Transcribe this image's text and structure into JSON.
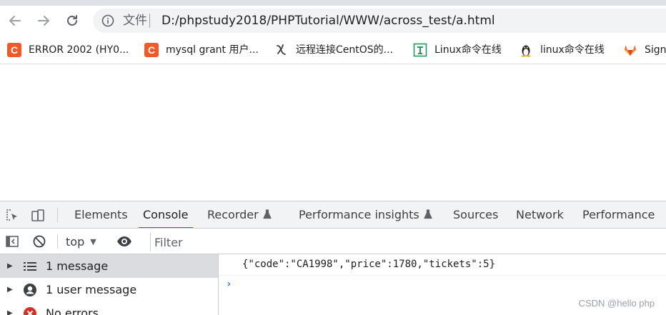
{
  "browser": {
    "address": {
      "file_label": "文件",
      "url": "D:/phpstudy2018/PHPTutorial/WWW/across_test/a.html"
    },
    "bookmarks": [
      {
        "label": "ERROR 2002 (HY0...",
        "icon": "csdn-c-icon"
      },
      {
        "label": "mysql grant 用户...",
        "icon": "csdn-c-icon"
      },
      {
        "label": "远程连接CentOS的...",
        "icon": "bookmark-logo-icon"
      },
      {
        "label": "Linux命令在线",
        "icon": "linux-command-icon"
      },
      {
        "label": "linux命令在线",
        "icon": "tux-icon"
      },
      {
        "label": "Sign",
        "icon": "gitlab-icon"
      }
    ]
  },
  "devtools": {
    "tabs": [
      {
        "label": "Elements"
      },
      {
        "label": "Console",
        "active": true
      },
      {
        "label": "Recorder"
      },
      {
        "label": "Performance insights"
      },
      {
        "label": "Sources"
      },
      {
        "label": "Network"
      },
      {
        "label": "Performance"
      }
    ],
    "console_bar": {
      "context": "top",
      "filter_placeholder": "Filter"
    },
    "sidebar": [
      {
        "label": "1 message",
        "icon": "list-icon",
        "selected": true
      },
      {
        "label": "1 user message",
        "icon": "user-icon"
      },
      {
        "label": "No errors",
        "icon": "error-icon"
      }
    ],
    "console": {
      "log": "{\"code\":\"CA1998\",\"price\":1780,\"tickets\":5}",
      "prompt": "›"
    },
    "watermark": "CSDN @hello php"
  },
  "colors": {
    "accent": "#1a73e8",
    "csdn": "#f05a28",
    "error": "#d93025"
  }
}
